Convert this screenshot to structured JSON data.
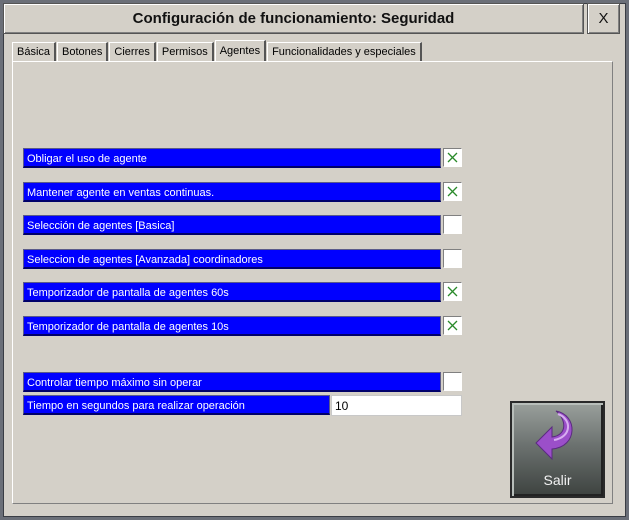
{
  "window": {
    "title": "Configuración de funcionamiento: Seguridad",
    "close_label": "X"
  },
  "tabs": [
    {
      "label": "Básica"
    },
    {
      "label": "Botones"
    },
    {
      "label": "Cierres"
    },
    {
      "label": "Permisos"
    },
    {
      "label": "Agentes",
      "active": true
    },
    {
      "label": "Funcionalidades y especiales"
    }
  ],
  "options": [
    {
      "label": "Obligar el uso de agente",
      "checked": true
    },
    {
      "label": "Mantener agente en ventas continuas.",
      "checked": true
    },
    {
      "label": "Selección de agentes [Basica]",
      "checked": false
    },
    {
      "label": "Seleccion de agentes [Avanzada] coordinadores",
      "checked": false
    },
    {
      "label": "Temporizador de pantalla de agentes 60s",
      "checked": true
    },
    {
      "label": "Temporizador de pantalla de agentes 10s",
      "checked": true
    },
    {
      "label": "Controlar tiempo máximo sin operar",
      "checked": false
    }
  ],
  "timeout": {
    "label": "Tiempo en segundos para realizar operación",
    "value": "10"
  },
  "exit_button": {
    "label": "Salir",
    "icon": "return-arrow-icon"
  },
  "colors": {
    "label_bg": "#0000ff",
    "label_text": "#ffffff",
    "check_mark": "#2a8a2a",
    "panel_bg": "#d4d0c8",
    "arrow": "#9b4fc9"
  }
}
